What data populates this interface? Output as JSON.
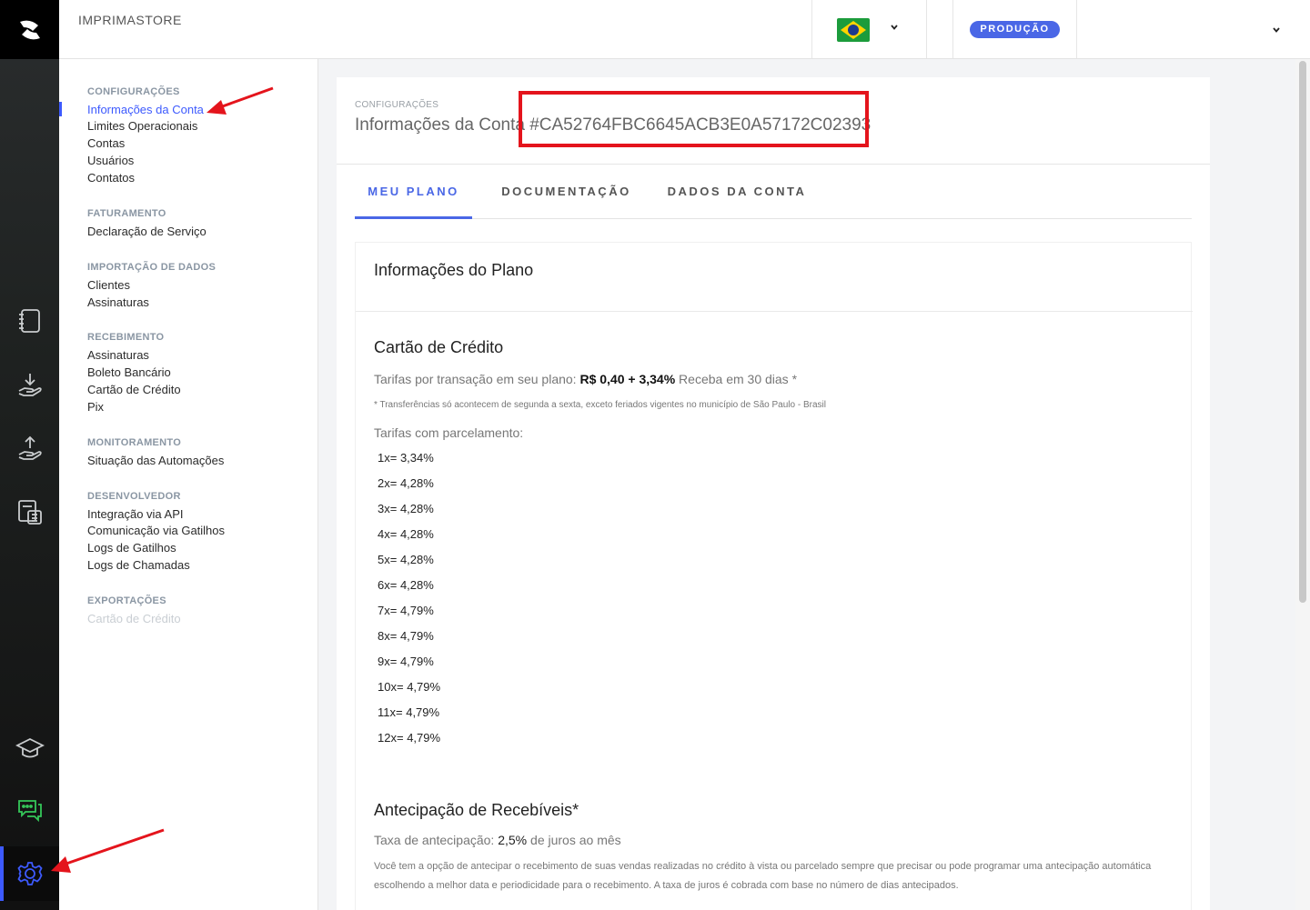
{
  "header": {
    "store_name": "IMPRIMASTORE",
    "environment_badge": "PRODUÇÃO",
    "country_flag": "brazil-flag-icon"
  },
  "rail": {
    "icons": [
      "logo-icon",
      "notebook-icon",
      "hand-download-icon",
      "hand-upload-icon",
      "calculator-icon",
      "graduation-cap-icon",
      "chat-icon",
      "gear-icon"
    ],
    "accent_color": "#3d5afe",
    "chat_color": "#35c759"
  },
  "sidebar": {
    "sections": [
      {
        "title": "CONFIGURAÇÕES",
        "items": [
          "Informações da Conta",
          "Limites Operacionais",
          "Contas",
          "Usuários",
          "Contatos"
        ]
      },
      {
        "title": "FATURAMENTO",
        "items": [
          "Declaração de Serviço"
        ]
      },
      {
        "title": "IMPORTAÇÃO DE DADOS",
        "items": [
          "Clientes",
          "Assinaturas"
        ]
      },
      {
        "title": "RECEBIMENTO",
        "items": [
          "Assinaturas",
          "Boleto Bancário",
          "Cartão de Crédito",
          "Pix"
        ]
      },
      {
        "title": "MONITORAMENTO",
        "items": [
          "Situação das Automações"
        ]
      },
      {
        "title": "DESENVOLVEDOR",
        "items": [
          "Integração via API",
          "Comunicação via Gatilhos",
          "Logs de Gatilhos",
          "Logs de Chamadas"
        ]
      },
      {
        "title": "EXPORTAÇÕES",
        "items": [
          "Cartão de Crédito"
        ]
      }
    ],
    "active_item": "Informações da Conta"
  },
  "page": {
    "breadcrumb": "CONFIGURAÇÕES",
    "title": "Informações da Conta #CA52764FBC6645ACB3E0A57172C02393",
    "tabs": [
      "MEU PLANO",
      "DOCUMENTAÇÃO",
      "DADOS DA CONTA"
    ],
    "active_tab": "MEU PLANO"
  },
  "plan": {
    "heading": "Informações do Plano",
    "credit_card": {
      "heading": "Cartão de Crédito",
      "fees_prefix": "Tarifas por transação em seu plano:",
      "fees_value": "R$ 0,40 + 3,34%",
      "fees_suffix": "Receba em 30 dias *",
      "note": "* Transferências só acontecem de segunda a sexta, exceto feriados vigentes no município de São Paulo - Brasil",
      "installments_label": "Tarifas com parcelamento:",
      "installments": [
        {
          "n": "1x=",
          "rate": "3,34%"
        },
        {
          "n": "2x=",
          "rate": "4,28%"
        },
        {
          "n": "3x=",
          "rate": "4,28%"
        },
        {
          "n": "4x=",
          "rate": "4,28%"
        },
        {
          "n": "5x=",
          "rate": "4,28%"
        },
        {
          "n": "6x=",
          "rate": "4,28%"
        },
        {
          "n": "7x=",
          "rate": "4,79%"
        },
        {
          "n": "8x=",
          "rate": "4,79%"
        },
        {
          "n": "9x=",
          "rate": "4,79%"
        },
        {
          "n": "10x=",
          "rate": "4,79%"
        },
        {
          "n": "11x=",
          "rate": "4,79%"
        },
        {
          "n": "12x=",
          "rate": "4,79%"
        }
      ]
    },
    "anticipation": {
      "heading": "Antecipação de Recebíveis*",
      "rate_prefix": "Taxa de antecipação:",
      "rate_value": "2,5%",
      "rate_suffix": "de juros ao mês",
      "description": "Você tem a opção de antecipar o recebimento de suas vendas realizadas no crédito à vista ou parcelado sempre que precisar ou pode programar uma antecipação automática escolhendo a melhor data e periodicidade para o recebimento. A taxa de juros é cobrada com base no número de dias antecipados."
    }
  }
}
